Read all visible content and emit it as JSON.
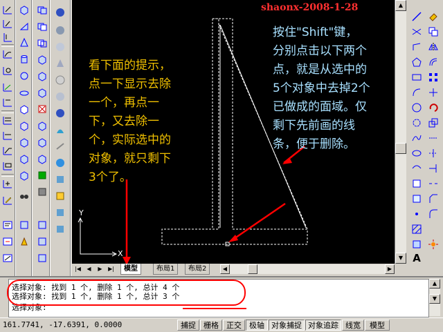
{
  "watermark": "shaonx-2008-1-28",
  "annotations": {
    "left_note": "看下面的提示，\n点一下显示去除\n一个，再点一\n下，又去除一\n个，实际选中的\n对象，就只剩下\n3个了。",
    "right_note": "按住\"Shift\"键，\n分别点击以下两个\n点，就是从选中的\n5个对象中去掉2个\n已做成的面域。仅\n剩下先前画的线\n条，便于删除。",
    "left_note_color": "#f0c000",
    "right_note_color": "#a8e0ff",
    "arrow_color": "#ff0000"
  },
  "ucs": {
    "x_label": "X",
    "y_label": "Y"
  },
  "layout_tabs": [
    "模型",
    "布局1",
    "布局2"
  ],
  "tab_nav": [
    "|◀",
    "◀",
    "▶",
    "▶|"
  ],
  "command_history": [
    "选择对象: 找到 1 个, 删除 1 个, 总计 4 个",
    "选择对象: 找到 1 个, 删除 1 个, 总计 3 个"
  ],
  "command_prompt": "选择对象:",
  "status": {
    "coordinates": "161.7741, -17.6391, 0.0000",
    "toggles": [
      "捕捉",
      "栅格",
      "正交",
      "极轴",
      "对象捕捉",
      "对象追踪",
      "线宽",
      "模型"
    ]
  },
  "right_toolbar_letter": "A"
}
